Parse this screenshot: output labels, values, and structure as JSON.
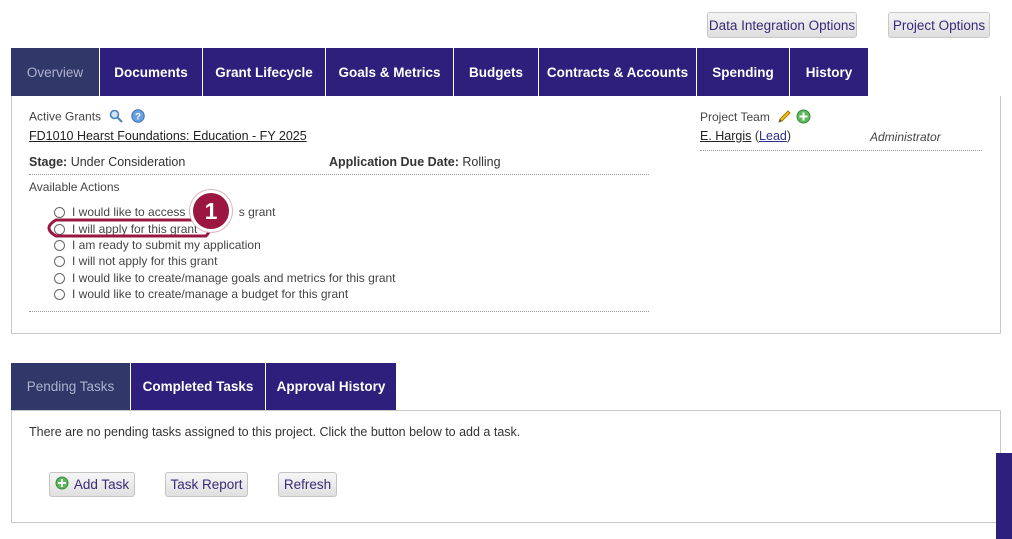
{
  "top_buttons": {
    "data_integration": "Data Integration Options",
    "project_options": "Project Options"
  },
  "main_tabs": [
    {
      "label": "Overview"
    },
    {
      "label": "Documents"
    },
    {
      "label": "Grant Lifecycle"
    },
    {
      "label": "Goals & Metrics"
    },
    {
      "label": "Budgets"
    },
    {
      "label": "Contracts & Accounts"
    },
    {
      "label": "Spending"
    },
    {
      "label": "History"
    }
  ],
  "overview": {
    "active_grants_label": "Active Grants",
    "grant_link": "FD1010 Hearst Foundations: Education - FY 2025",
    "stage_label": "Stage:",
    "stage_value": "Under Consideration",
    "due_label": "Application Due Date:",
    "due_value": "Rolling",
    "actions_label": "Available Actions",
    "actions": [
      {
        "label": "I would like to access d             s grant"
      },
      {
        "label": "I will apply for this grant"
      },
      {
        "label": "I am ready to submit my application"
      },
      {
        "label": "I will not apply for this grant"
      },
      {
        "label": "I would like to create/manage goals and metrics for this grant"
      },
      {
        "label": "I would like to create/manage a budget for this grant"
      }
    ],
    "callout_number": "1",
    "project_team_label": "Project Team",
    "member_name": "E. Hargis",
    "member_lead": "Lead",
    "member_role": "Administrator"
  },
  "task_tabs": [
    {
      "label": "Pending Tasks"
    },
    {
      "label": "Completed Tasks"
    },
    {
      "label": "Approval History"
    }
  ],
  "tasks": {
    "empty_message": "There are no pending tasks assigned to this project. Click the button below to add a task.",
    "add_task": "Add Task",
    "task_report": "Task Report",
    "refresh": "Refresh"
  },
  "colors": {
    "tab_bg": "#2d1f7b",
    "tab_active_bg": "#303769",
    "callout": "#9b1742"
  }
}
